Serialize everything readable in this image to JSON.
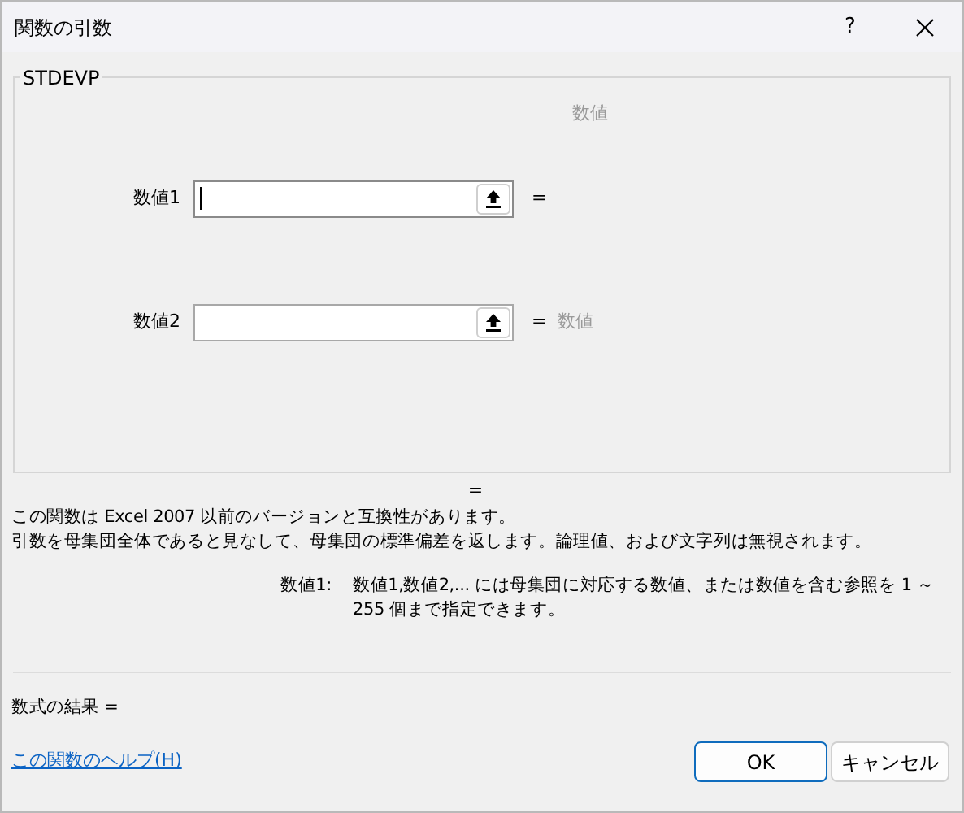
{
  "window": {
    "title": "関数の引数",
    "help": "?"
  },
  "function_name": "STDEVP",
  "top_note": "数値",
  "args": [
    {
      "label": "数値1",
      "focused": true
    },
    {
      "label": "数値2",
      "focused": false,
      "result": "数値"
    }
  ],
  "eq_sign": "=",
  "overall_result": "=",
  "description": [
    "この関数は Excel 2007 以前のバージョンと互換性があります。",
    "引数を母集団全体であると見なして、母集団の標準偏差を返します。論理値、および文字列は無視されます。"
  ],
  "arg_help": {
    "label": "数値1:",
    "text": "数値1,数値2,... には母集団に対応する数値、または数値を含む参照を 1 ～ 255 個まで指定できます。"
  },
  "formula_result": "数式の結果 =",
  "help_link": "この関数のヘルプ(H)",
  "buttons": [
    {
      "label": "OK",
      "default": true
    },
    {
      "label": "キャンセル",
      "default": false
    }
  ]
}
